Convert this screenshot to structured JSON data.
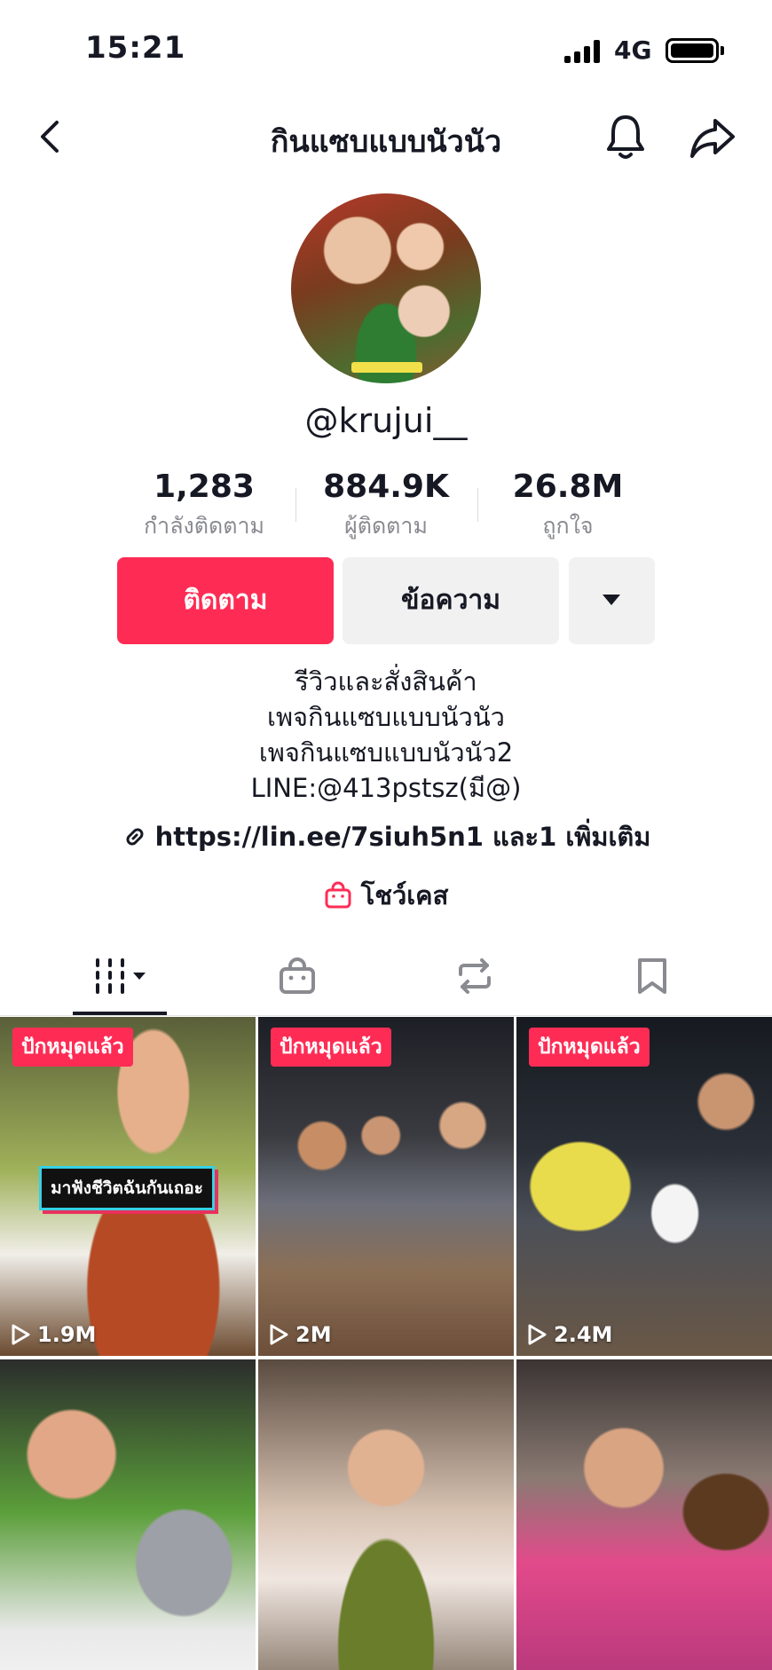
{
  "status_bar": {
    "time": "15:21",
    "network": "4G"
  },
  "header": {
    "title": "กินแซบแบบนัวนัว"
  },
  "profile": {
    "username": "@krujui__",
    "stats": [
      {
        "value": "1,283",
        "label": "กำลังติดตาม"
      },
      {
        "value": "884.9K",
        "label": "ผู้ติดตาม"
      },
      {
        "value": "26.8M",
        "label": "ถูกใจ"
      }
    ],
    "follow_label": "ติดตาม",
    "message_label": "ข้อความ",
    "bio_lines": [
      "รีวิวและสั่งสินค้า",
      "เพจกินแซบแบบนัวนัว",
      "เพจกินแซบแบบนัวนัว2",
      "LINE:@413pstsz(มี@)"
    ],
    "link_text": "https://lin.ee/7siuh5n1 และ1 เพิ่มเติม",
    "showcase_label": "โชว์เคส"
  },
  "tabs": [
    {
      "icon": "videos-grid-icon",
      "active": true
    },
    {
      "icon": "shop-bag-icon",
      "active": false
    },
    {
      "icon": "repost-icon",
      "active": false
    },
    {
      "icon": "bookmark-icon",
      "active": false
    }
  ],
  "videos": [
    {
      "pinned_label": "ปักหมุดแล้ว",
      "views": "1.9M",
      "caption": "มาฟังชีวิตฉันกันเถอะ"
    },
    {
      "pinned_label": "ปักหมุดแล้ว",
      "views": "2M"
    },
    {
      "pinned_label": "ปักหมุดแล้ว",
      "views": "2.4M"
    },
    {},
    {},
    {}
  ],
  "colors": {
    "accent": "#fe2c55",
    "secondary_button": "#f1f1f2",
    "text_primary": "#161823",
    "text_secondary": "#8a8b91"
  }
}
